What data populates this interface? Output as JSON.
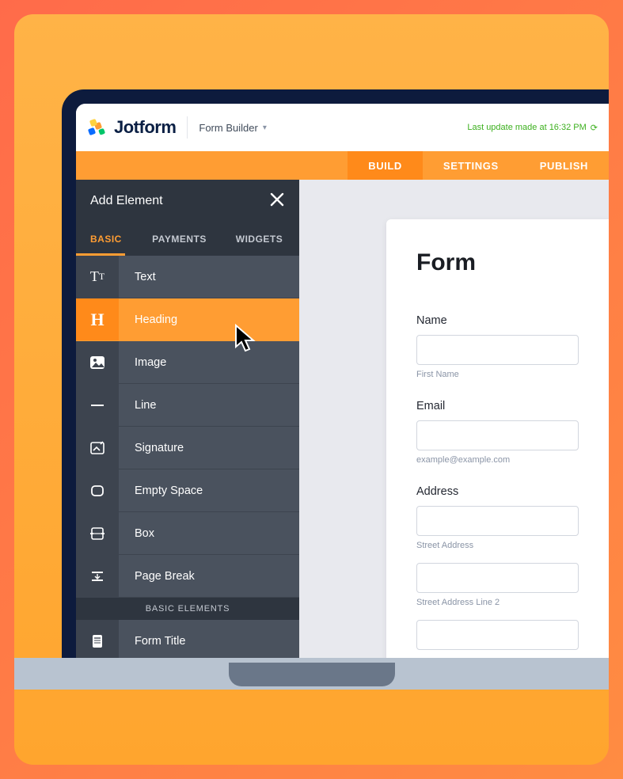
{
  "header": {
    "brand": "Jotform",
    "page": "Form Builder",
    "update_status": "Last update made at 16:32 PM"
  },
  "nav": {
    "tabs": [
      "BUILD",
      "SETTINGS",
      "PUBLISH"
    ],
    "active": 0
  },
  "sidebar": {
    "title": "Add Element",
    "tabs": [
      "BASIC",
      "PAYMENTS",
      "WIDGETS"
    ],
    "active_tab": 0,
    "section_label": "BASIC ELEMENTS",
    "elements": [
      {
        "label": "Text"
      },
      {
        "label": "Heading",
        "selected": true
      },
      {
        "label": "Image"
      },
      {
        "label": "Line"
      },
      {
        "label": "Signature"
      },
      {
        "label": "Empty Space"
      },
      {
        "label": "Box"
      },
      {
        "label": "Page Break"
      },
      {
        "label": "Form Title"
      }
    ]
  },
  "form": {
    "title": "Form",
    "name_label": "Name",
    "name_hint": "First Name",
    "email_label": "Email",
    "email_hint": "example@example.com",
    "address_label": "Address",
    "address_hint1": "Street Address",
    "address_hint2": "Street Address Line 2"
  }
}
